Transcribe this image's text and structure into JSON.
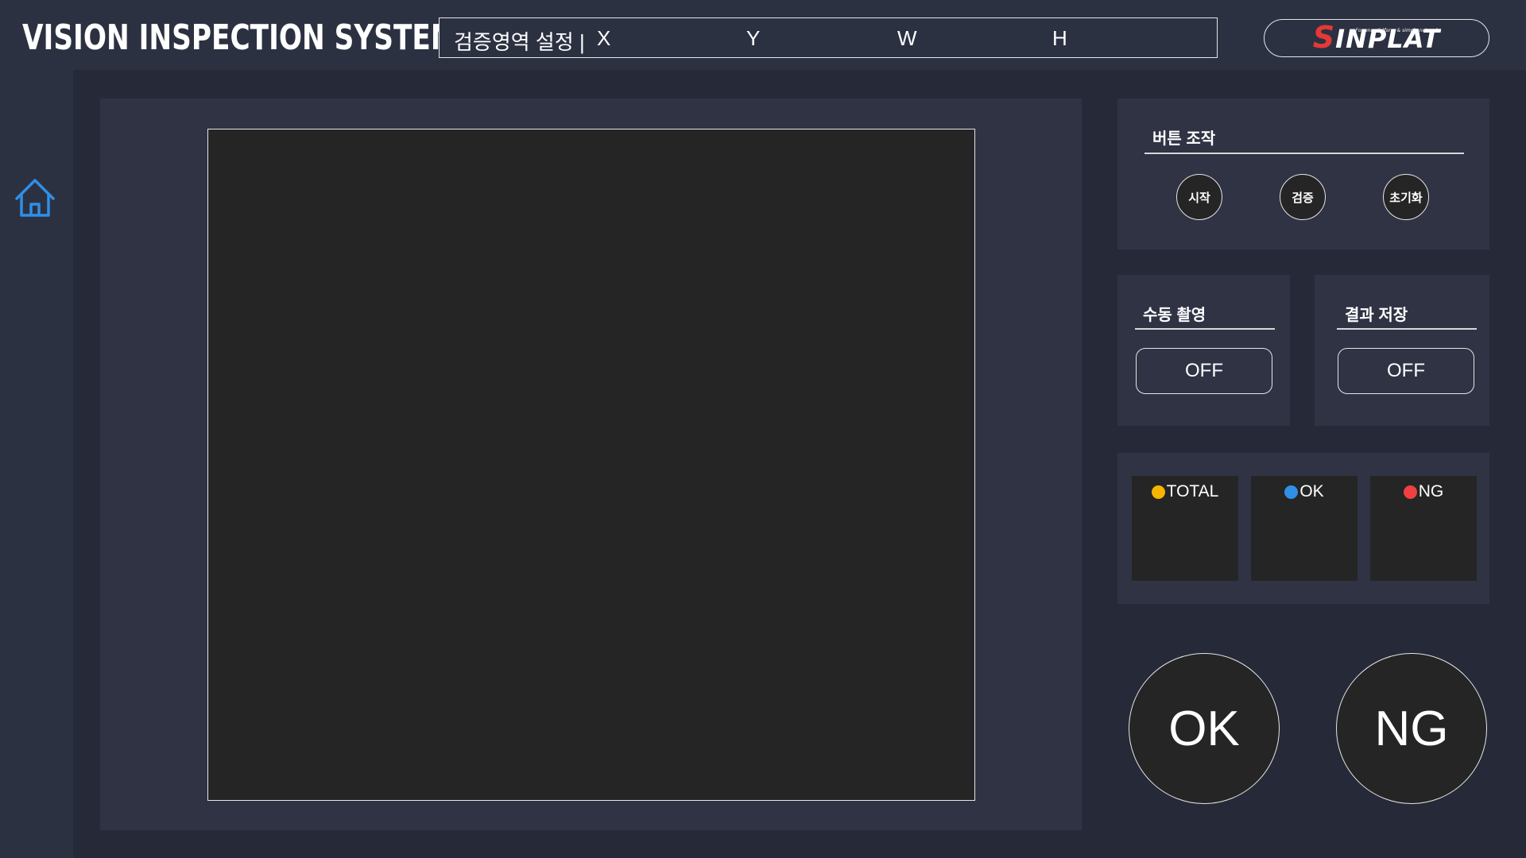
{
  "header": {
    "app_title": "VISION INSPECTION SYSTEM",
    "roi": {
      "label": "검증영역 설정 |",
      "x_label": "X",
      "y_label": "Y",
      "w_label": "W",
      "h_label": "H"
    },
    "brand": {
      "logo_first": "S",
      "logo_rest": "INPLAT",
      "tagline": "For one platform & simple network",
      "accent_color": "#e53935"
    }
  },
  "sidebar": {
    "home_icon": "home-icon",
    "home_color": "#2f8fe6"
  },
  "controls": {
    "title": "버튼 조작",
    "start_label": "시작",
    "verify_label": "검증",
    "reset_label": "초기화"
  },
  "manual_capture": {
    "title": "수동 촬영",
    "state": "OFF"
  },
  "save_result": {
    "title": "결과 저장",
    "state": "OFF"
  },
  "counters": {
    "total": {
      "label": "TOTAL",
      "value": "",
      "color": "#f7b500"
    },
    "ok": {
      "label": "OK",
      "value": "",
      "color": "#2f8fe6"
    },
    "ng": {
      "label": "NG",
      "value": "",
      "color": "#f04040"
    }
  },
  "result": {
    "ok_label": "OK",
    "ng_label": "NG"
  }
}
